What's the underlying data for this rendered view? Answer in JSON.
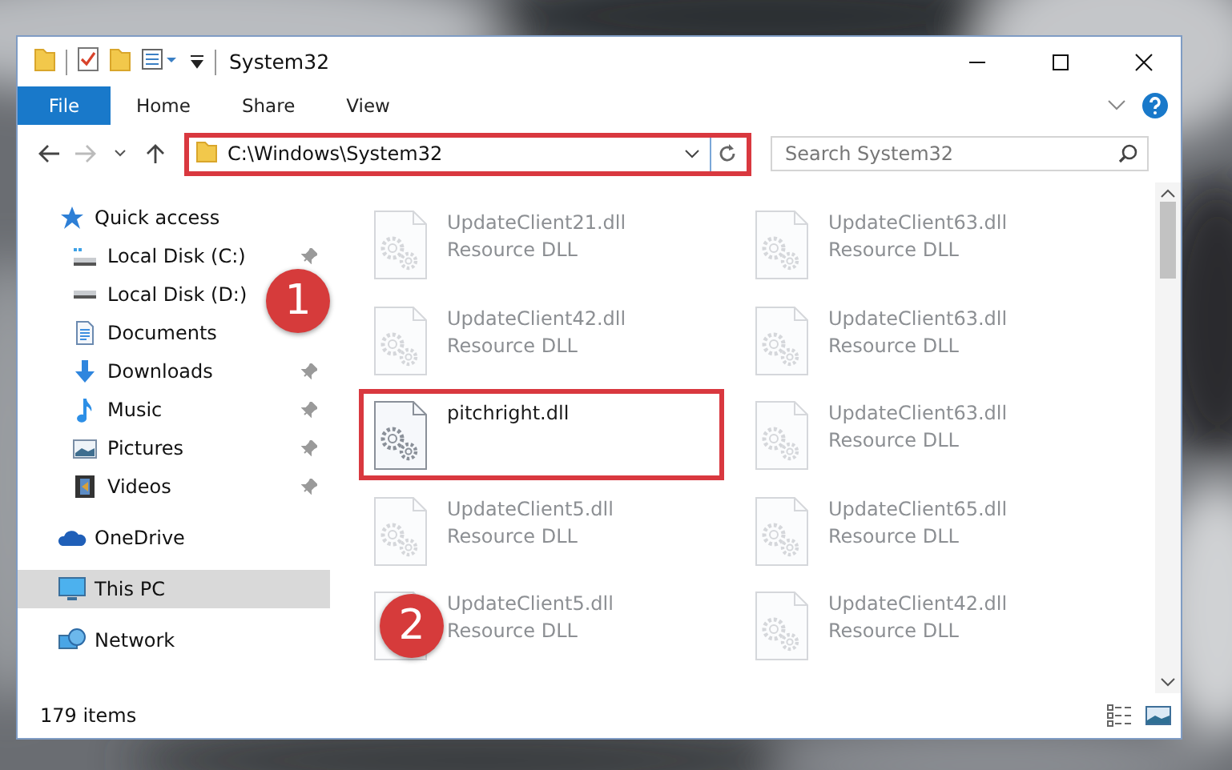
{
  "window": {
    "title": "System32"
  },
  "ribbon_tabs": [
    {
      "label": "File",
      "selected": true
    },
    {
      "label": "Home",
      "selected": false
    },
    {
      "label": "Share",
      "selected": false
    },
    {
      "label": "View",
      "selected": false
    }
  ],
  "address": {
    "value": "C:\\Windows\\System32",
    "marked": true
  },
  "search": {
    "placeholder": "Search System32"
  },
  "sidebar": {
    "items": [
      {
        "label": "Quick access",
        "kind": "star",
        "selected": false,
        "children": [
          {
            "label": "Local Disk (C:)",
            "kind": "disk-c",
            "pinned": true,
            "selected": false
          },
          {
            "label": "Local Disk (D:)",
            "kind": "disk",
            "selected": false
          },
          {
            "label": "Documents",
            "kind": "document",
            "selected": false
          },
          {
            "label": "Downloads",
            "kind": "download",
            "pinned": true,
            "selected": false
          },
          {
            "label": "Music",
            "kind": "music",
            "pinned": true,
            "selected": false
          },
          {
            "label": "Pictures",
            "kind": "pictures",
            "pinned": true,
            "selected": false
          },
          {
            "label": "Videos",
            "kind": "videos",
            "pinned": true,
            "selected": false
          }
        ]
      },
      {
        "label": "OneDrive",
        "kind": "cloud",
        "selected": false
      },
      {
        "label": "This PC",
        "kind": "pc",
        "selected": true
      },
      {
        "label": "Network",
        "kind": "network",
        "selected": false
      }
    ]
  },
  "files": [
    {
      "name": "UpdateClient21.dll",
      "type": "Resource DLL",
      "blurred": true,
      "marked": false
    },
    {
      "name": "UpdateClient63.dll",
      "type": "Resource DLL",
      "blurred": true,
      "marked": false
    },
    {
      "name": "UpdateClient42.dll",
      "type": "Resource DLL",
      "blurred": true,
      "marked": false
    },
    {
      "name": "UpdateClient63.dll",
      "type": "Resource DLL",
      "blurred": true,
      "marked": false
    },
    {
      "name": "pitchright.dll",
      "blurred": false,
      "marked": true
    },
    {
      "name": "UpdateClient63.dll",
      "type": "Resource DLL",
      "blurred": true,
      "marked": false
    },
    {
      "name": "UpdateClient5.dll",
      "type": "Resource DLL",
      "blurred": true,
      "marked": false
    },
    {
      "name": "UpdateClient65.dll",
      "type": "Resource DLL",
      "blurred": true,
      "marked": false
    },
    {
      "name": "UpdateClient5.dll",
      "type": "Resource DLL",
      "blurred": true,
      "marked": false
    },
    {
      "name": "UpdateClient42.dll",
      "type": "Resource DLL",
      "blurred": true,
      "marked": false
    }
  ],
  "status_bar": {
    "item_count": "179 items"
  },
  "annotations": [
    {
      "number": "1"
    },
    {
      "number": "2"
    }
  ]
}
